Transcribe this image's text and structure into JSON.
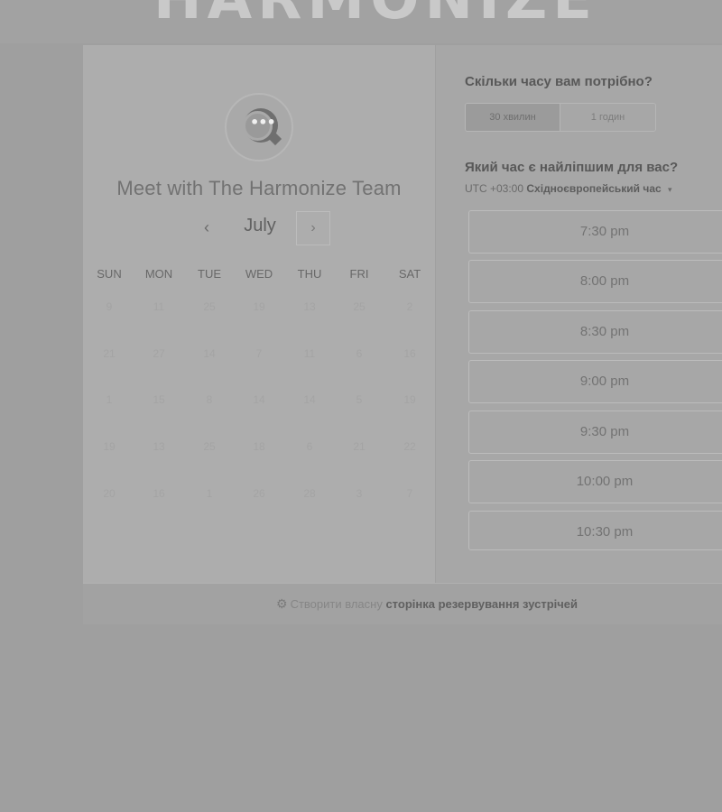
{
  "background": {
    "logo_text": "HARMONIZE"
  },
  "meeting": {
    "title": "Meet with The Harmonize Team"
  },
  "calendar": {
    "month": "July",
    "prev_label": "‹",
    "next_label": "›",
    "weekdays": [
      "SUN",
      "MON",
      "TUE",
      "WED",
      "THU",
      "FRI",
      "SAT"
    ],
    "weeks": [
      [
        "9",
        "11",
        "25",
        "19",
        "13",
        "25",
        "2"
      ],
      [
        "21",
        "27",
        "14",
        "7",
        "11",
        "6",
        "16"
      ],
      [
        "1",
        "15",
        "8",
        "14",
        "14",
        "5",
        "19"
      ],
      [
        "19",
        "13",
        "25",
        "18",
        "6",
        "21",
        "22"
      ],
      [
        "20",
        "16",
        "1",
        "26",
        "28",
        "3",
        "7"
      ]
    ]
  },
  "duration": {
    "question": "Скільки часу вам потрібно?",
    "options": [
      "30 хвилин",
      "1 годин"
    ],
    "selected": "30 хвилин"
  },
  "schedule": {
    "question": "Який час є найліпшим для вас?",
    "timezone_offset": "UTC +03:00",
    "timezone_name": "Східноєвропейський час",
    "timezone_caret": "▾",
    "slots": [
      "7:30 pm",
      "8:00 pm",
      "8:30 pm",
      "9:00 pm",
      "9:30 pm",
      "10:00 pm",
      "10:30 pm"
    ]
  },
  "footer": {
    "icon": "sprocket-icon",
    "text_prefix": "Створити власну",
    "text_bold": "сторінка резервування зустрічей"
  }
}
